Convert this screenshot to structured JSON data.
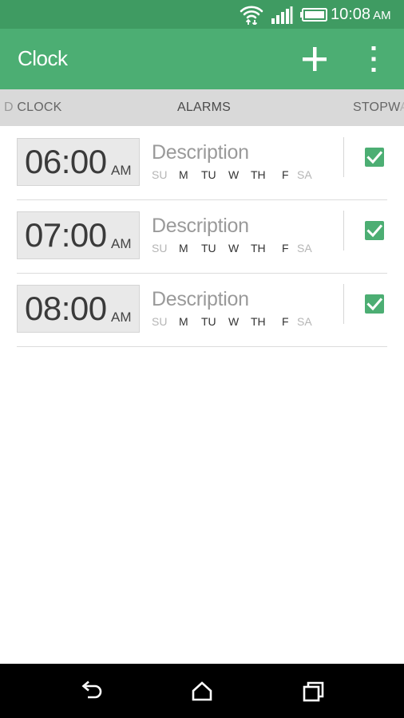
{
  "status_bar": {
    "time": "10:08",
    "ampm": "AM",
    "icons": [
      "wifi-icon",
      "signal-icon",
      "battery-icon"
    ]
  },
  "app_bar": {
    "title": "Clock",
    "actions": [
      "add-icon",
      "more-vert-icon"
    ]
  },
  "tabs": {
    "clock": {
      "cut": "D",
      "label": "CLOCK"
    },
    "alarms": {
      "label": "ALARMS",
      "selected": true
    },
    "stopwatch": {
      "visible": "STOPW",
      "faded": "A"
    }
  },
  "alarms": [
    {
      "time": "06:00",
      "ampm": "AM",
      "description": "Description",
      "enabled": true,
      "days": [
        {
          "label": "SU",
          "active": false
        },
        {
          "label": "M",
          "active": true
        },
        {
          "label": "TU",
          "active": true
        },
        {
          "label": "W",
          "active": true
        },
        {
          "label": "TH",
          "active": true
        },
        {
          "label": "F",
          "active": true
        },
        {
          "label": "SA",
          "active": false
        }
      ]
    },
    {
      "time": "07:00",
      "ampm": "AM",
      "description": "Description",
      "enabled": true,
      "days": [
        {
          "label": "SU",
          "active": false
        },
        {
          "label": "M",
          "active": true
        },
        {
          "label": "TU",
          "active": true
        },
        {
          "label": "W",
          "active": true
        },
        {
          "label": "TH",
          "active": true
        },
        {
          "label": "F",
          "active": true
        },
        {
          "label": "SA",
          "active": false
        }
      ]
    },
    {
      "time": "08:00",
      "ampm": "AM",
      "description": "Description",
      "enabled": true,
      "days": [
        {
          "label": "SU",
          "active": false
        },
        {
          "label": "M",
          "active": true
        },
        {
          "label": "TU",
          "active": true
        },
        {
          "label": "W",
          "active": true
        },
        {
          "label": "TH",
          "active": true
        },
        {
          "label": "F",
          "active": true
        },
        {
          "label": "SA",
          "active": false
        }
      ]
    }
  ],
  "nav_bar": {
    "buttons": [
      "back-icon",
      "home-icon",
      "recent-apps-icon"
    ]
  },
  "colors": {
    "status_bar": "#3f9b62",
    "app_bar": "#4cae73",
    "accent": "#4cae73",
    "tab_strip": "#d9d9d9"
  }
}
